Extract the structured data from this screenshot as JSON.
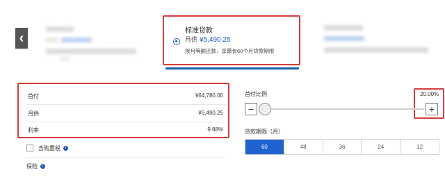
{
  "nav": {
    "prev_icon": "chevron-left-icon",
    "prev_glyph": "‹"
  },
  "plan": {
    "title": "标准贷款",
    "monthly_label": "月供",
    "monthly_amount": "¥5,490.25",
    "description": "按月等额还款，享最长60个月贷款期限"
  },
  "summary": {
    "rows": [
      {
        "label": "首付",
        "value": "¥64,780.00"
      },
      {
        "label": "月供",
        "value": "¥5,490.25"
      },
      {
        "label": "利率",
        "value": "9.88%"
      }
    ]
  },
  "options": {
    "tax_label": "含购置税",
    "insurance_label": "保险",
    "info_glyph": "i"
  },
  "down_payment": {
    "label": "首付比例",
    "percent": "20.00%",
    "minus_glyph": "−",
    "plus_glyph": "+"
  },
  "term": {
    "label": "贷款期限（月）",
    "options": [
      "60",
      "48",
      "36",
      "24",
      "12"
    ],
    "selected": "60"
  },
  "colors": {
    "accent": "#1f63d1",
    "highlight": "#d93b3b"
  }
}
